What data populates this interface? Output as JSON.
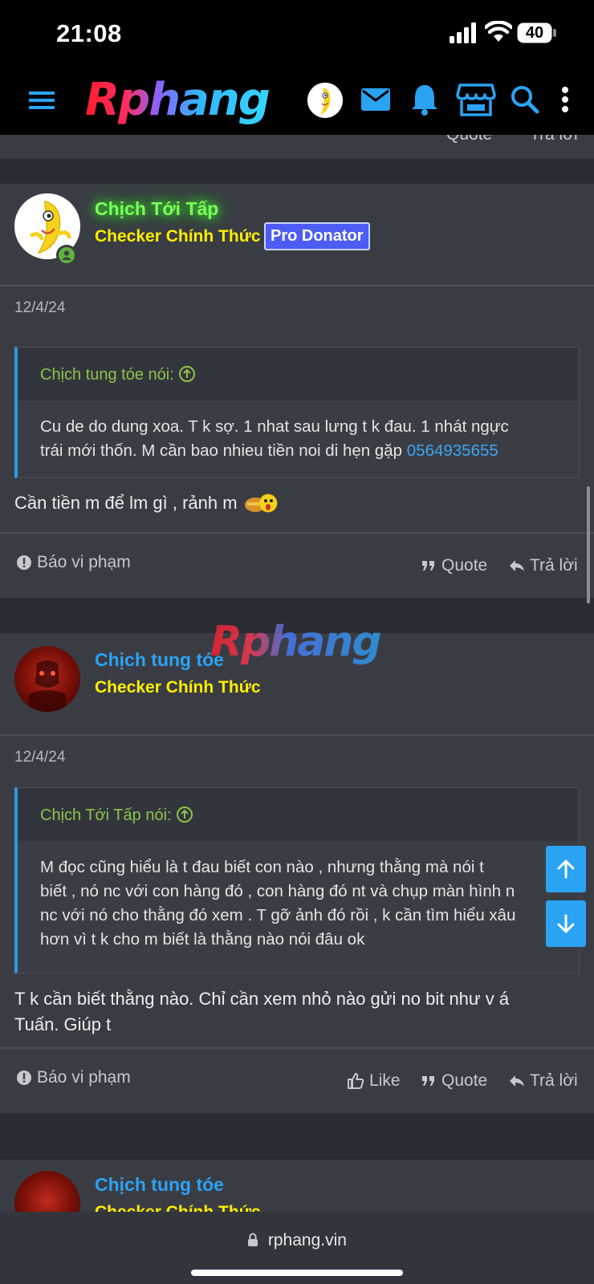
{
  "status_bar": {
    "time": "21:08",
    "battery": "40"
  },
  "header": {
    "logo": "Rphang"
  },
  "prev_footer": {
    "quote": "Quote",
    "reply": "Trả lời"
  },
  "posts": [
    {
      "username": "Chịch Tới Tấp",
      "user_title": "Checker Chính Thức",
      "banner": "Pro Donator",
      "date": "12/4/24",
      "quote_author": "Chịch tung tóe nói:",
      "quote_lines": [
        "Cu de do dung xoa. T k sợ. 1 nhat sau lưng t k đau. 1 nhát ngực",
        "trái mới thốn. M cần bao nhieu tiền noi di hẹn gặp "
      ],
      "quote_phone": "0564935655",
      "message": "Cần tiền m để lm gì , rảnh m",
      "report": "Báo vi phạm",
      "quote_btn": "Quote",
      "reply_btn": "Trả lời"
    },
    {
      "username": "Chịch tung tóe",
      "user_title": "Checker Chính Thức",
      "date": "12/4/24",
      "quote_author": "Chịch Tới Tấp nói:",
      "quote_lines": [
        "M đọc cũng hiểu là t đau biết con nào , nhưng thằng mà nói t",
        "biết , nó nc với con hàng đó , con hàng đó nt và chụp màn hình n",
        "nc với nó cho thằng đó xem . T gỡ ảnh đó rồi , k cần tìm hiểu xâu",
        "hơn vì t k cho m biết là thằng nào nói đâu ok"
      ],
      "message_lines": [
        "T k cần biết thằng nào. Chỉ cần xem nhỏ nào gửi no bit như v á",
        "Tuấn. Giúp t"
      ],
      "report": "Báo vi phạm",
      "like_btn": "Like",
      "quote_btn": "Quote",
      "reply_btn": "Trả lời"
    },
    {
      "username": "Chịch tung tóe",
      "user_title": "Checker Chính Thức"
    }
  ],
  "watermark": "Rphang",
  "browser": {
    "url": "rphang.vin"
  },
  "colors": {
    "accent": "#2ba3f3",
    "title_yellow": "#ffee00",
    "quote_green": "#8ac44a"
  }
}
